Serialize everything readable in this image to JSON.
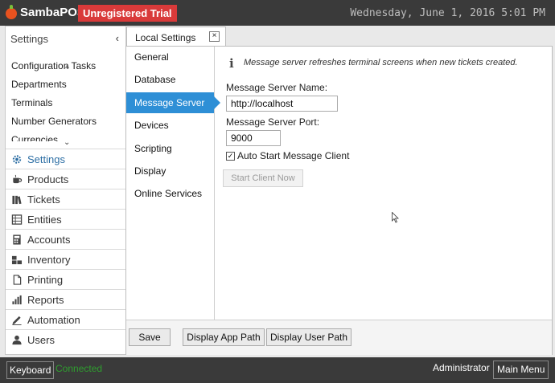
{
  "header": {
    "app_title": "SambaPOS",
    "trial_badge": "Unregistered Trial",
    "datetime": "Wednesday, June 1, 2016 5:01 PM"
  },
  "left_panel": {
    "header_label": "Settings",
    "collapse_glyph": "‹",
    "config_items": [
      "Configuration Tasks",
      "Departments",
      "Terminals",
      "Number Generators",
      "Currencies"
    ],
    "nav_items": [
      {
        "label": "Settings",
        "icon": "gear-icon",
        "active": true
      },
      {
        "label": "Products",
        "icon": "cup-icon"
      },
      {
        "label": "Tickets",
        "icon": "books-icon"
      },
      {
        "label": "Entities",
        "icon": "table-icon"
      },
      {
        "label": "Accounts",
        "icon": "calculator-icon"
      },
      {
        "label": "Inventory",
        "icon": "inventory-icon"
      },
      {
        "label": "Printing",
        "icon": "document-icon"
      },
      {
        "label": "Reports",
        "icon": "bar-chart-icon"
      },
      {
        "label": "Automation",
        "icon": "pen-icon"
      },
      {
        "label": "Users",
        "icon": "user-icon"
      }
    ]
  },
  "main": {
    "tab_label": "Local Settings",
    "tab_close": "×",
    "submenu": [
      "General",
      "Database",
      "Message Server",
      "Devices",
      "Scripting",
      "Display",
      "Online Services"
    ],
    "active_submenu": "Message Server",
    "info_text": "Message server refreshes terminal screens when new tickets created.",
    "server_name_label": "Message Server Name:",
    "server_name_value": "http://localhost",
    "server_port_label": "Message Server Port:",
    "server_port_value": "9000",
    "auto_start_label": "Auto Start Message Client",
    "auto_start_checked": true,
    "start_client_label": "Start Client Now",
    "buttons": {
      "save": "Save",
      "display_app_path": "Display App Path",
      "display_user_path": "Display User Path"
    }
  },
  "status_bar": {
    "keyboard": "Keyboard",
    "connected": "Connected",
    "user": "Administrator",
    "main_menu": "Main Menu"
  },
  "colors": {
    "accent": "#2e8fd6",
    "trial": "#d93a3a",
    "connected": "#2f9e2f",
    "topbar": "#3a3a3a"
  }
}
